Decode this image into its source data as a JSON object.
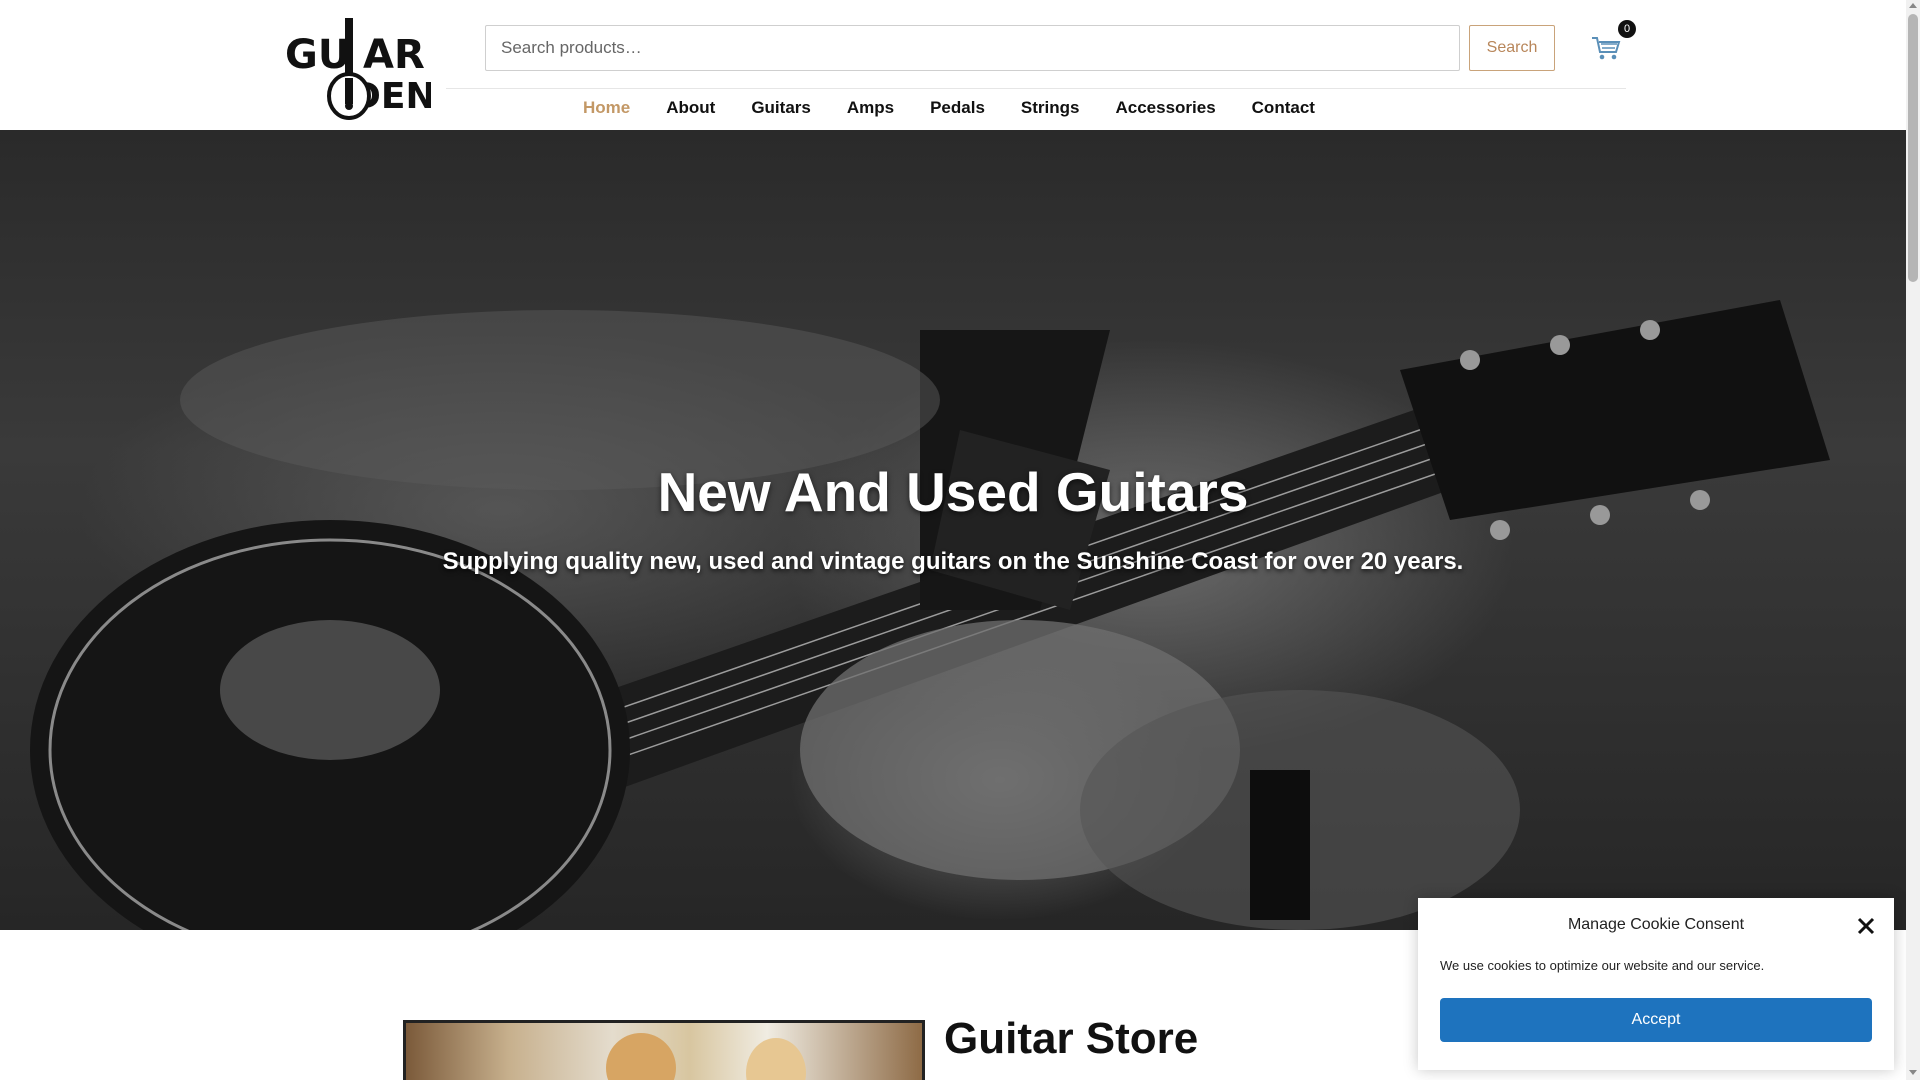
{
  "header": {
    "logo_text": [
      "GUITAR",
      "DEN"
    ],
    "search": {
      "placeholder": "Search products…",
      "button_label": "Search"
    },
    "cart": {
      "icon": "cart-icon",
      "count": "0"
    }
  },
  "nav": {
    "items": [
      {
        "label": "Home",
        "active": true
      },
      {
        "label": "About"
      },
      {
        "label": "Guitars"
      },
      {
        "label": "Amps"
      },
      {
        "label": "Pedals"
      },
      {
        "label": "Strings"
      },
      {
        "label": "Accessories"
      },
      {
        "label": "Contact"
      }
    ],
    "active_color": "#c39866"
  },
  "hero": {
    "title": "New And Used Guitars",
    "subtitle": "Supplying quality new, used and vintage guitars on the Sunshine Coast for over 20 years."
  },
  "main": {
    "section_title": "Guitar Store"
  },
  "cookie": {
    "title": "Manage Cookie Consent",
    "text": "We use cookies to optimize our website and our service.",
    "accept_label": "Accept",
    "close_icon": "close-icon",
    "accent": "#1e73be"
  }
}
